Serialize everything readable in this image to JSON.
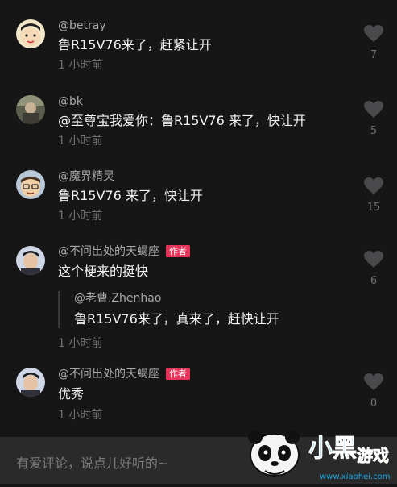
{
  "comments": [
    {
      "username": "@betray",
      "author_badge": "",
      "text": "鲁R15V76来了，赶紧让开",
      "time": "1 小时前",
      "likes": "7",
      "avatar": "cartoon-boy-avatar"
    },
    {
      "username": "@bk",
      "author_badge": "",
      "text": "@至尊宝我爱你：鲁R15V76 来了，快让开",
      "time": "1 小时前",
      "likes": "5",
      "avatar": "photo-avatar"
    },
    {
      "username": "@魔界精灵",
      "author_badge": "",
      "text": "鲁R15V76 来了，快让开",
      "time": "1 小时前",
      "likes": "15",
      "avatar": "cartoon-man-avatar"
    },
    {
      "username": "@不问出处的天蝎座",
      "author_badge": "作者",
      "text": "这个梗来的挺快",
      "time": "1 小时前",
      "likes": "6",
      "avatar": "person-avatar",
      "reply": {
        "username": "@老曹.Zhenhao",
        "text": "鲁R15V76来了，真来了，赶快让开"
      }
    },
    {
      "username": "@不问出处的天蝎座",
      "author_badge": "作者",
      "text": "优秀",
      "time": "1 小时前",
      "likes": "0",
      "avatar": "person-avatar"
    }
  ],
  "input": {
    "placeholder": "有爱评论，说点儿好听的~"
  },
  "watermark": {
    "brand_text": "小黑游戏",
    "url_text": "www.xiaohei.com"
  },
  "colors": {
    "background": "#161616",
    "author_badge": "#e8345a",
    "muted_text": "#6f6f72"
  }
}
